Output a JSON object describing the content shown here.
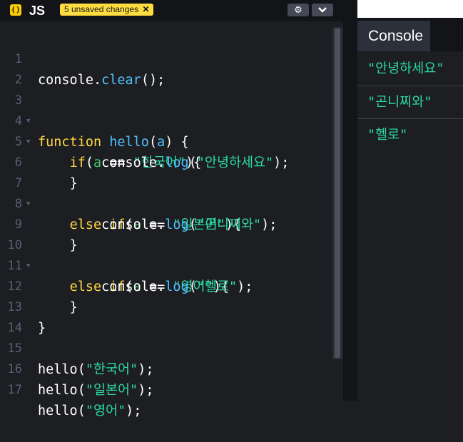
{
  "editor": {
    "language": "JS",
    "icon_glyph": "()",
    "unsaved_badge": "5 unsaved changes",
    "unsaved_close": "✕",
    "settings_glyph": "⚙",
    "collapse_glyph": "⌄",
    "line_numbers": [
      "1",
      "2",
      "3",
      "4",
      "5",
      "6",
      "7",
      "8",
      "9",
      "10",
      "11",
      "12",
      "13",
      "14",
      "15",
      "16",
      "17"
    ]
  },
  "code": {
    "l1": {
      "a": "console",
      "b": ".",
      "c": "clear",
      "d": "();"
    },
    "l3": {
      "a": "function",
      "b": " ",
      "c": "hello",
      "d": "(",
      "e": "a",
      "f": ") {"
    },
    "l4": {
      "indent": "    ",
      "a": "if",
      "b": "(",
      "c": "a",
      "d": " == ",
      "e": "\"한국어\"",
      "f": "){"
    },
    "l5": {
      "indent": "        ",
      "a": "console",
      "b": ".",
      "c": "log",
      "d": "(",
      "e": "\"안녕하세요\"",
      "f": ");"
    },
    "l6": {
      "indent": "    ",
      "a": "}"
    },
    "l7": {
      "indent": "    ",
      "a": "else",
      "b": " ",
      "c": "if",
      "d": "(",
      "e": "a",
      "f": " == ",
      "g": "\"일본어\"",
      "h": "){"
    },
    "l8": {
      "indent": "        ",
      "a": "console",
      "b": ".",
      "c": "log",
      "d": "(",
      "e": "\"곤니찌와\"",
      "f": ");"
    },
    "l9": {
      "indent": "    ",
      "a": "}"
    },
    "l10": {
      "indent": "    ",
      "a": "else",
      "b": " ",
      "c": "if",
      "d": "(",
      "e": "a",
      "f": " == ",
      "g": "\"영어\"",
      "h": "){"
    },
    "l11": {
      "indent": "        ",
      "a": "console",
      "b": ".",
      "c": "log",
      "d": "(",
      "e": "\"헬로\"",
      "f": ");"
    },
    "l12": {
      "indent": "    ",
      "a": "}"
    },
    "l13": {
      "a": "}"
    },
    "l15": {
      "a": "hello",
      "b": "(",
      "c": "\"한국어\"",
      "d": ");"
    },
    "l16": {
      "a": "hello",
      "b": "(",
      "c": "\"일본어\"",
      "d": ");"
    },
    "l17": {
      "a": "hello",
      "b": "(",
      "c": "\"영어\"",
      "d": ");"
    }
  },
  "console": {
    "tab_label": "Console",
    "logs": [
      "\"안녕하세요\"",
      "\"곤니찌와\"",
      "\"헬로\""
    ]
  },
  "colors": {
    "background": "#1d1e22",
    "header": "#131417",
    "badge": "#ffdd40",
    "string": "#2bd9a3",
    "function": "#4dc0ff",
    "keyword": "#ffd742",
    "variable": "#3fcc64"
  }
}
